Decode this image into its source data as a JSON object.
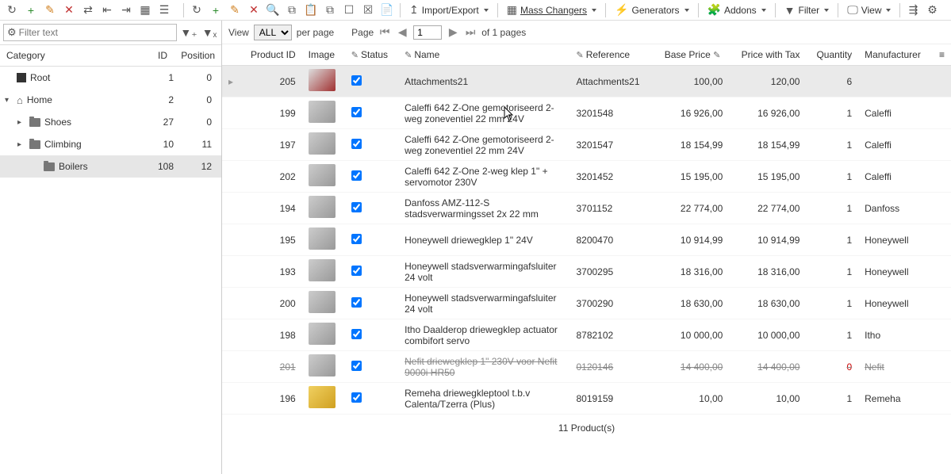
{
  "top_toolbar": {
    "left_icons": [
      "refresh",
      "plus",
      "pencil",
      "delete",
      "swap",
      "indent-left",
      "indent-right",
      "grid",
      "select-clear"
    ],
    "right_icons": [
      "refresh",
      "plus",
      "pencil",
      "delete",
      "search",
      "copy",
      "paste",
      "multi-copy",
      "select",
      "deselect",
      "clipboard",
      "up-arrow"
    ],
    "buttons": [
      {
        "icon": "up-arrow",
        "label": "Import/Export",
        "dropdown": true
      },
      {
        "icon": "grid",
        "label": "Mass Changers",
        "dropdown": true,
        "underline": true
      },
      {
        "icon": "bolt",
        "label": "Generators",
        "dropdown": true
      },
      {
        "icon": "puzzle",
        "label": "Addons",
        "dropdown": true
      },
      {
        "icon": "funnel",
        "label": "Filter",
        "dropdown": true
      },
      {
        "icon": "screen",
        "label": "View",
        "dropdown": true
      },
      {
        "icon": "tree",
        "label": "",
        "dropdown": false
      },
      {
        "icon": "gear",
        "label": "",
        "dropdown": false
      }
    ]
  },
  "filter": {
    "placeholder": "Filter text"
  },
  "tree": {
    "headers": {
      "category": "Category",
      "id": "ID",
      "position": "Position"
    },
    "rows": [
      {
        "indent": 0,
        "toggle": "",
        "icon": "root",
        "label": "Root",
        "id": "1",
        "pos": "0",
        "selected": false
      },
      {
        "indent": 0,
        "toggle": "▾",
        "icon": "home",
        "label": "Home",
        "id": "2",
        "pos": "0",
        "selected": false
      },
      {
        "indent": 1,
        "toggle": "▸",
        "icon": "folder",
        "label": "Shoes",
        "id": "27",
        "pos": "0",
        "selected": false
      },
      {
        "indent": 1,
        "toggle": "▸",
        "icon": "folder",
        "label": "Climbing",
        "id": "10",
        "pos": "11",
        "selected": false
      },
      {
        "indent": 2,
        "toggle": "",
        "icon": "folder",
        "label": "Boilers",
        "id": "108",
        "pos": "12",
        "selected": true
      }
    ]
  },
  "paging": {
    "view_label": "View",
    "view_value": "ALL",
    "per_page": "per page",
    "page_label": "Page",
    "page_value": "1",
    "of_pages": "of 1 pages"
  },
  "grid": {
    "headers": {
      "product_id": "Product ID",
      "image": "Image",
      "status": "Status",
      "name": "Name",
      "reference": "Reference",
      "base_price": "Base Price",
      "price_tax": "Price with Tax",
      "quantity": "Quantity",
      "manufacturer": "Manufacturer"
    },
    "rows": [
      {
        "pid": "205",
        "img": "red",
        "status": true,
        "name": "Attachments21",
        "ref": "Attachments21",
        "base": "100,00",
        "tax": "120,00",
        "qty": "6",
        "mfr": "",
        "selected": true,
        "strike": false
      },
      {
        "pid": "199",
        "img": "",
        "status": true,
        "name": "Caleffi 642 Z-One gemotoriseerd 2-weg zoneventiel 22 mm 24V",
        "ref": "3201548",
        "base": "16 926,00",
        "tax": "16 926,00",
        "qty": "1",
        "mfr": "Caleffi",
        "selected": false,
        "strike": false
      },
      {
        "pid": "197",
        "img": "",
        "status": true,
        "name": "Caleffi 642 Z-One gemotoriseerd 2-weg zoneventiel 22 mm 24V",
        "ref": "3201547",
        "base": "18 154,99",
        "tax": "18 154,99",
        "qty": "1",
        "mfr": "Caleffi",
        "selected": false,
        "strike": false
      },
      {
        "pid": "202",
        "img": "",
        "status": true,
        "name": "Caleffi 642 Z-One 2-weg klep 1\" + servomotor 230V",
        "ref": "3201452",
        "base": "15 195,00",
        "tax": "15 195,00",
        "qty": "1",
        "mfr": "Caleffi",
        "selected": false,
        "strike": false
      },
      {
        "pid": "194",
        "img": "",
        "status": true,
        "name": "Danfoss AMZ-112-S stadsverwarmingsset 2x 22 mm",
        "ref": "3701152",
        "base": "22 774,00",
        "tax": "22 774,00",
        "qty": "1",
        "mfr": "Danfoss",
        "selected": false,
        "strike": false
      },
      {
        "pid": "195",
        "img": "",
        "status": true,
        "name": "Honeywell driewegklep 1\" 24V",
        "ref": "8200470",
        "base": "10 914,99",
        "tax": "10 914,99",
        "qty": "1",
        "mfr": "Honeywell",
        "selected": false,
        "strike": false
      },
      {
        "pid": "193",
        "img": "",
        "status": true,
        "name": "Honeywell stadsverwarmingafsluiter 24 volt",
        "ref": "3700295",
        "base": "18 316,00",
        "tax": "18 316,00",
        "qty": "1",
        "mfr": "Honeywell",
        "selected": false,
        "strike": false
      },
      {
        "pid": "200",
        "img": "",
        "status": true,
        "name": "Honeywell stadsverwarmingafsluiter 24 volt",
        "ref": "3700290",
        "base": "18 630,00",
        "tax": "18 630,00",
        "qty": "1",
        "mfr": "Honeywell",
        "selected": false,
        "strike": false
      },
      {
        "pid": "198",
        "img": "",
        "status": true,
        "name": "Itho Daalderop driewegklep actuator combifort servo",
        "ref": "8782102",
        "base": "10 000,00",
        "tax": "10 000,00",
        "qty": "1",
        "mfr": "Itho",
        "selected": false,
        "strike": false
      },
      {
        "pid": "201",
        "img": "",
        "status": true,
        "name": "Nefit driewegklep 1\" 230V voor Nefit 9000i HR50",
        "ref": "0120146",
        "base": "14 400,00",
        "tax": "14 400,00",
        "qty": "0",
        "mfr": "Nefit",
        "selected": false,
        "strike": true
      },
      {
        "pid": "196",
        "img": "yellow",
        "status": true,
        "name": "Remeha driewegkleptool t.b.v Calenta/Tzerra (Plus)",
        "ref": "8019159",
        "base": "10,00",
        "tax": "10,00",
        "qty": "1",
        "mfr": "Remeha",
        "selected": false,
        "strike": false
      }
    ],
    "footer": "11 Product(s)"
  },
  "icons": {
    "refresh": "↻",
    "plus": "+",
    "pencil": "✎",
    "delete": "✕",
    "swap": "⇄",
    "indent-left": "⇤",
    "indent-right": "⇥",
    "grid": "▦",
    "select-clear": "☰",
    "search": "🔍",
    "copy": "⧉",
    "paste": "📋",
    "multi-copy": "⧉",
    "select": "☐",
    "deselect": "☒",
    "clipboard": "📄",
    "up-arrow": "↥",
    "bolt": "⚡",
    "puzzle": "🧩",
    "funnel": "▼",
    "screen": "🖵",
    "tree": "⇶",
    "gear": "⚙"
  }
}
